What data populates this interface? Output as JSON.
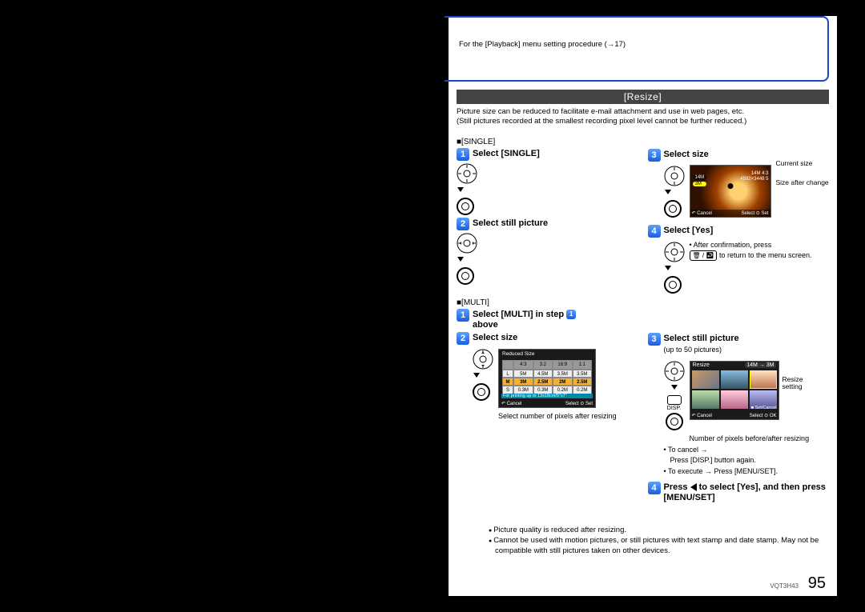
{
  "header": {
    "note": "For the [Playback] menu setting procedure (→17)"
  },
  "section": {
    "title": "[Resize]",
    "desc1": "Picture size can be reduced to facilitate e-mail attachment and use in web pages, etc.",
    "desc2": "(Still pictures recorded at the smallest recording pixel level cannot be further reduced.)"
  },
  "single": {
    "sub": "■[SINGLE]",
    "s1": "Select [SINGLE]",
    "s2": "Select still picture",
    "s3": "Select size",
    "s4": "Select [Yes]",
    "s4_note_a": "• After confirmation, press",
    "s4_note_b": " to return to the menu screen.",
    "preview_tag_top": "14M",
    "preview_tag_bot": "3M",
    "preview_info_top": "14M 4:3",
    "preview_info_main": "4592×3448 5",
    "preview_cancel": "↶ Cancel",
    "preview_set": "Select ⊙ Set",
    "callout1": "Current size",
    "callout2": "Size after change"
  },
  "multi": {
    "sub": "■[MULTI]",
    "s1a": "Select [MULTI] in step ",
    "s1b": " above",
    "s2": "Select  size",
    "s2_note": "Select number of pixels after resizing",
    "s3": "Select still picture",
    "s3_sub": "(up to 50 pictures)",
    "s3_note1": "Number of pixels before/after resizing",
    "s3_note2": "• To cancel →",
    "s3_note3": "Press [DISP.] button again.",
    "s3_note4": "• To execute → Press [MENU/SET].",
    "s4": "Press ◀ to select [Yes], and then press [MENU/SET]",
    "grid_title": "Resize",
    "grid_size": "14M → 3M",
    "grid_setcancel": "■ Set/Cancel",
    "grid_select": "Select ⊙ OK",
    "grid_cancel": "↶ Cancel",
    "callout3": "Resize setting",
    "disp_label": "DISP.",
    "size_title": "Reduced Size",
    "size_hint": "For printing up to 13x18cm/5\"x7\"",
    "size_cancel": "↶ Cancel",
    "size_set": "Select ⊙ Set",
    "table": {
      "hdr": [
        "",
        "4:3",
        "3:2",
        "16:9",
        "1:1"
      ],
      "rowL": [
        "L",
        "5M",
        "4.5M",
        "3.5M",
        "3.5M"
      ],
      "rowM": [
        "M",
        "3M",
        "2.5M",
        "2M",
        "2.5M"
      ],
      "rowS": [
        "S",
        "0.3M",
        "0.3M",
        "0.2M",
        "0.2M"
      ]
    }
  },
  "footnotes": {
    "a": "Picture quality is reduced after resizing.",
    "b": "Cannot be used with motion pictures, or still pictures with text stamp and date stamp. May not be compatible with still pictures taken on other devices."
  },
  "doc_id": "VQT3H43",
  "page_no": "95"
}
